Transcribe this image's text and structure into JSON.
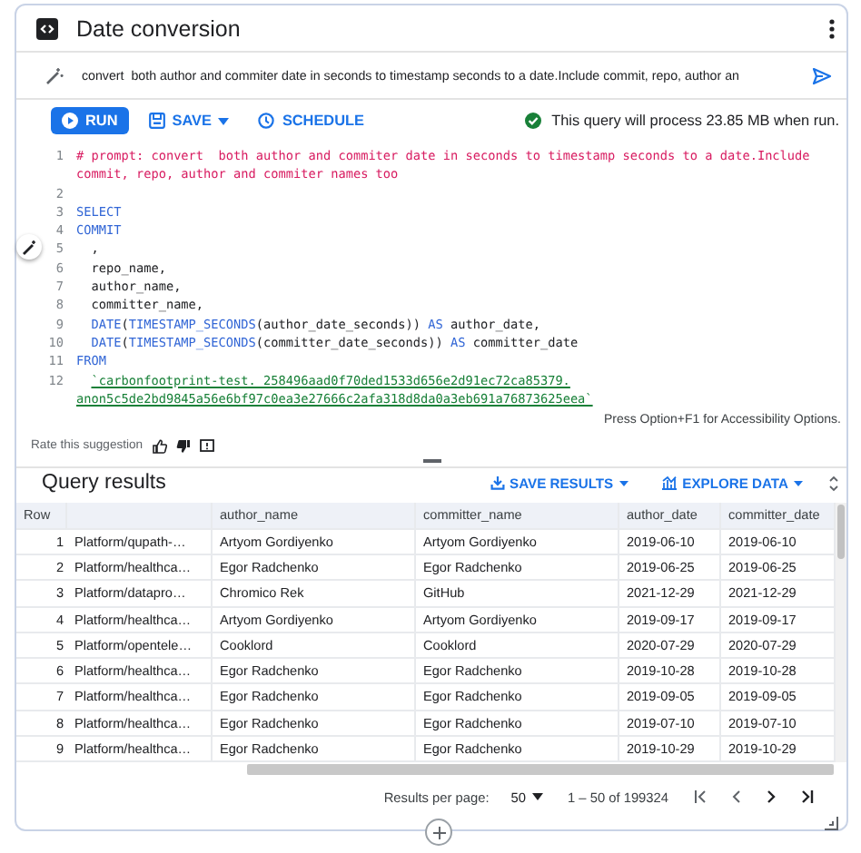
{
  "window": {
    "title": "Date conversion"
  },
  "prompt": {
    "value": "convert  both author and commiter date in seconds to timestamp seconds to a date.Include commit, repo, author an"
  },
  "toolbar": {
    "run": "RUN",
    "save": "SAVE",
    "schedule": "SCHEDULE",
    "estimate": "This query will process 23.85 MB when run."
  },
  "code": {
    "lines": [
      {
        "number": "1",
        "segments": [
          {
            "kind": "comment",
            "text": "# prompt: convert  both author and commiter date in seconds to timestamp seconds to a date.Include"
          },
          {
            "kind": "break"
          },
          {
            "kind": "comment",
            "text": "commit, repo, author and commiter names too"
          }
        ]
      },
      {
        "number": "2"
      },
      {
        "number": "3",
        "segments": [
          {
            "kind": "keyword",
            "text": "SELECT"
          }
        ]
      },
      {
        "number": "4",
        "segments": [
          {
            "kind": "keyword",
            "text": "COMMIT"
          }
        ]
      },
      {
        "number": "5",
        "segments": [
          {
            "kind": "plain",
            "text": "  ,"
          }
        ]
      },
      {
        "number": "6",
        "segments": [
          {
            "kind": "plain",
            "text": "  repo_name,"
          }
        ]
      },
      {
        "number": "7",
        "segments": [
          {
            "kind": "plain",
            "text": "  author_name,"
          }
        ]
      },
      {
        "number": "8",
        "segments": [
          {
            "kind": "plain",
            "text": "  committer_name,"
          }
        ]
      },
      {
        "number": "9",
        "segments": [
          {
            "kind": "indent"
          },
          {
            "kind": "keyword",
            "text": "DATE"
          },
          {
            "kind": "plain",
            "text": "("
          },
          {
            "kind": "keyword",
            "text": "TIMESTAMP_SECONDS"
          },
          {
            "kind": "plain",
            "text": "(author_date_seconds)) "
          },
          {
            "kind": "keyword",
            "text": "AS"
          },
          {
            "kind": "plain",
            "text": " author_date,"
          }
        ]
      },
      {
        "number": "10",
        "segments": [
          {
            "kind": "indent"
          },
          {
            "kind": "keyword",
            "text": "DATE"
          },
          {
            "kind": "plain",
            "text": "("
          },
          {
            "kind": "keyword",
            "text": "TIMESTAMP_SECONDS"
          },
          {
            "kind": "plain",
            "text": "(committer_date_seconds)) "
          },
          {
            "kind": "keyword",
            "text": "AS"
          },
          {
            "kind": "plain",
            "text": " committer_date"
          }
        ]
      },
      {
        "number": "11",
        "segments": [
          {
            "kind": "keyword",
            "text": "FROM"
          }
        ]
      },
      {
        "number": "12",
        "segments": [
          {
            "kind": "indent"
          },
          {
            "kind": "string",
            "text": "`carbonfootprint-test._258496aad0f70ded1533d656e2d91ec72ca85379."
          },
          {
            "kind": "break"
          },
          {
            "kind": "string",
            "text": "anon5c5de2bd9845a56e6bf97c0ea3e27666c2afa318d8da0a3eb691a76873625eea`"
          }
        ]
      }
    ]
  },
  "accessibility_hint": "Press Option+F1 for Accessibility Options.",
  "rating": {
    "label": "Rate this suggestion"
  },
  "results": {
    "title": "Query results",
    "save_results": "SAVE RESULTS",
    "explore_data": "EXPLORE DATA",
    "headers": {
      "row": "Row",
      "author_name": "author_name",
      "committer_name": "committer_name",
      "author_date": "author_date",
      "committer_date": "committer_date"
    },
    "rows": [
      {
        "row": "1",
        "column_2": "Platform/qupath-…",
        "author_name": "Artyom Gordiyenko",
        "committer_name": "Artyom Gordiyenko",
        "author_date": "2019-06-10",
        "committer_date": "2019-06-10"
      },
      {
        "row": "2",
        "column_2": "Platform/healthca…",
        "author_name": "Egor Radchenko",
        "committer_name": "Egor Radchenko",
        "author_date": "2019-06-25",
        "committer_date": "2019-06-25"
      },
      {
        "row": "3",
        "column_2": "Platform/datapro…",
        "author_name": "Chromico Rek",
        "committer_name": "GitHub",
        "author_date": "2021-12-29",
        "committer_date": "2021-12-29"
      },
      {
        "row": "4",
        "column_2": "Platform/healthca…",
        "author_name": "Artyom Gordiyenko",
        "committer_name": "Artyom Gordiyenko",
        "author_date": "2019-09-17",
        "committer_date": "2019-09-17"
      },
      {
        "row": "5",
        "column_2": "Platform/opentele…",
        "author_name": "Cooklord",
        "committer_name": "Cooklord",
        "author_date": "2020-07-29",
        "committer_date": "2020-07-29"
      },
      {
        "row": "6",
        "column_2": "Platform/healthca…",
        "author_name": "Egor Radchenko",
        "committer_name": "Egor Radchenko",
        "author_date": "2019-10-28",
        "committer_date": "2019-10-28"
      },
      {
        "row": "7",
        "column_2": "Platform/healthca…",
        "author_name": "Egor Radchenko",
        "committer_name": "Egor Radchenko",
        "author_date": "2019-09-05",
        "committer_date": "2019-09-05"
      },
      {
        "row": "8",
        "column_2": "Platform/healthca…",
        "author_name": "Egor Radchenko",
        "committer_name": "Egor Radchenko",
        "author_date": "2019-07-10",
        "committer_date": "2019-07-10"
      },
      {
        "row": "9",
        "column_2": "Platform/healthca…",
        "author_name": "Egor Radchenko",
        "committer_name": "Egor Radchenko",
        "author_date": "2019-10-29",
        "committer_date": "2019-10-29"
      }
    ]
  },
  "pagination": {
    "label": "Results per page:",
    "page_size": "50",
    "range": "1 – 50 of 199324"
  }
}
